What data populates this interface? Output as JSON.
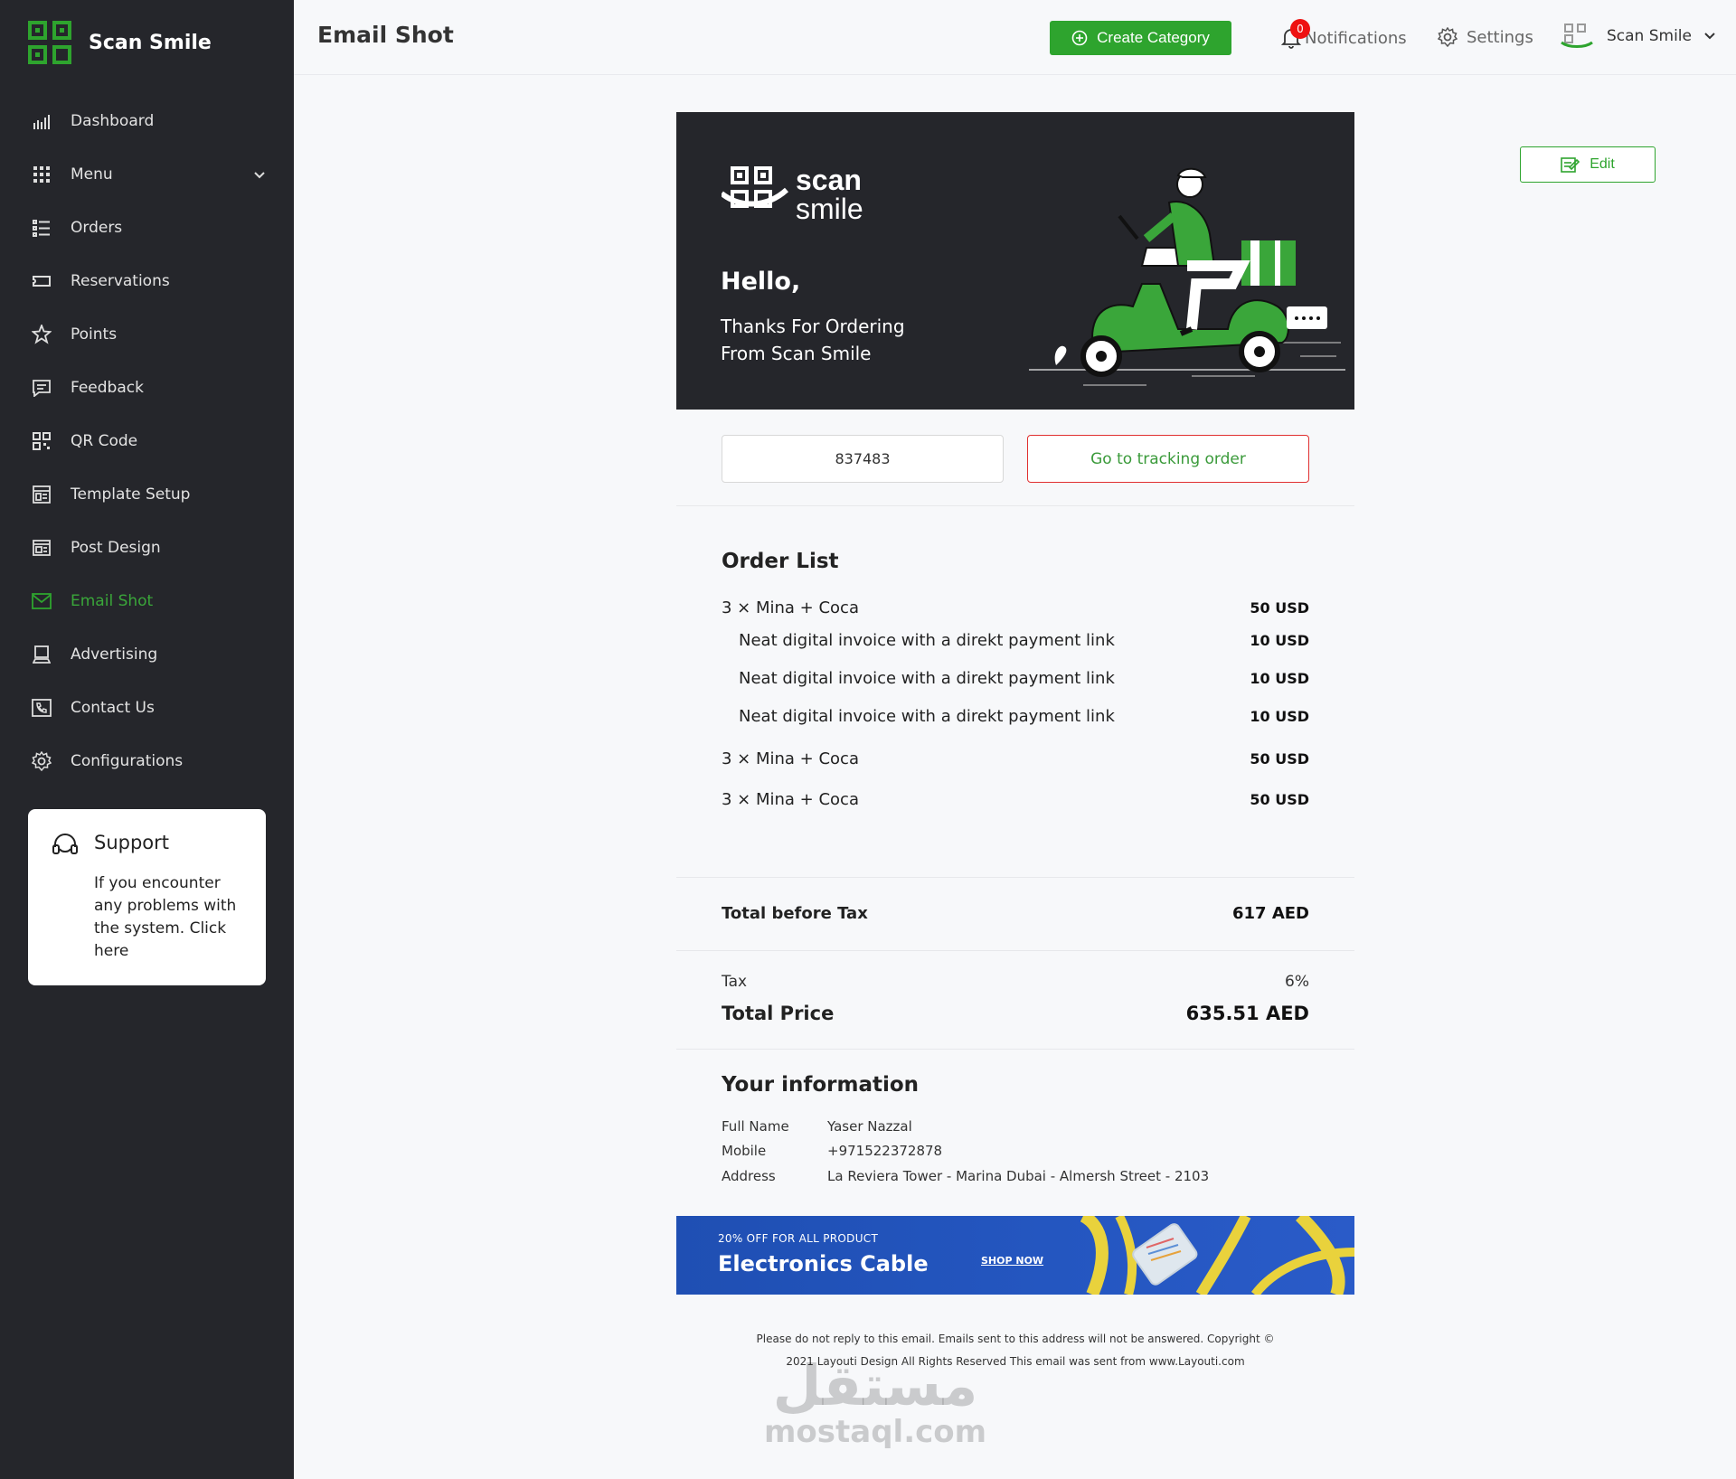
{
  "colors": {
    "accent": "#2ea42e",
    "sidebar_bg": "#25262b",
    "danger": "#e03030"
  },
  "sidebar": {
    "brand": "Scan Smile",
    "items": [
      {
        "label": "Dashboard",
        "icon": "chart-icon",
        "active": false
      },
      {
        "label": "Menu",
        "icon": "grid-icon",
        "active": false,
        "has_chevron": true
      },
      {
        "label": "Orders",
        "icon": "list-icon",
        "active": false
      },
      {
        "label": "Reservations",
        "icon": "ticket-icon",
        "active": false
      },
      {
        "label": "Points",
        "icon": "star-badge-icon",
        "active": false
      },
      {
        "label": "Feedback",
        "icon": "message-icon",
        "active": false
      },
      {
        "label": "QR Code",
        "icon": "qr-icon",
        "active": false
      },
      {
        "label": "Template Setup",
        "icon": "template-icon",
        "active": false
      },
      {
        "label": "Post Design",
        "icon": "post-icon",
        "active": false
      },
      {
        "label": "Email Shot",
        "icon": "mail-icon",
        "active": true
      },
      {
        "label": "Advertising",
        "icon": "laptop-icon",
        "active": false
      },
      {
        "label": "Contact Us",
        "icon": "phone-icon",
        "active": false
      },
      {
        "label": "Configurations",
        "icon": "gear-icon",
        "active": false
      }
    ],
    "support": {
      "title": "Support",
      "text": "If you encounter any problems with the system. Click here"
    }
  },
  "topbar": {
    "title": "Email Shot",
    "create_label": "Create Category",
    "notifications_label": "Notifications",
    "notifications_count": "0",
    "settings_label": "Settings",
    "profile_name": "Scan Smile"
  },
  "email": {
    "logo_line1": "scan",
    "logo_line2": "smile",
    "hello": "Hello,",
    "thanks": "Thanks For Ordering From Scan Smile",
    "order_code": "837483",
    "track_label": "Go to tracking order",
    "order_title": "Order List",
    "items": [
      {
        "label": "3 × Mina + Coca",
        "amount": "50 USD"
      },
      {
        "label": "Neat digital invoice with a direkt payment link",
        "amount": "10 USD"
      },
      {
        "label": "Neat digital invoice with a direkt payment link",
        "amount": "10 USD"
      },
      {
        "label": "Neat digital invoice with a direkt payment link",
        "amount": "10 USD"
      },
      {
        "label": "3 × Mina + Coca",
        "amount": "50 USD"
      },
      {
        "label": "3 × Mina + Coca",
        "amount": "50 USD"
      }
    ],
    "total_before_tax_label": "Total before Tax",
    "total_before_tax": "617 AED",
    "tax_label": "Tax",
    "tax": "6%",
    "total_price_label": "Total Price",
    "total_price": "635.51 AED",
    "info_title": "Your information",
    "info": {
      "name_label": "Full Name",
      "name": "Yaser Nazzal",
      "mobile_label": "Mobile",
      "mobile": "+971522372878",
      "address_label": "Address",
      "address": "La Reviera Tower - Marina Dubai - Almersh Street - 2103"
    },
    "banner": {
      "small": "20% OFF FOR ALL PRODUCT",
      "big": "Electronics Cable",
      "shop": "SHOP NOW"
    },
    "footer_line1": "Please do not reply to this email. Emails sent to this address will not be answered. Copyright ©",
    "footer_line2": "2021 Layouti Design All Rights Reserved This email was sent from www.Layouti.com"
  },
  "edit_label": "Edit",
  "watermark": {
    "arabic": "مستقل",
    "latin": "mostaql.com"
  }
}
